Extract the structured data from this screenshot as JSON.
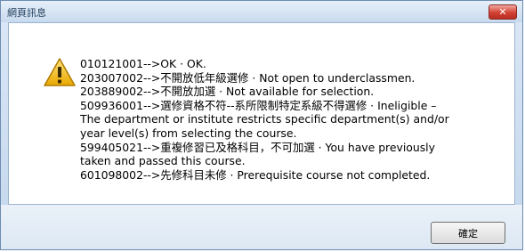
{
  "window": {
    "title": "網頁訊息",
    "close_label": "✕"
  },
  "message": {
    "lines": [
      "010121001-->OK · OK.",
      "203007002-->不開放低年級選修 · Not open to underclassmen.",
      "203889002-->不開放加選 · Not available for selection.",
      "509936001-->選修資格不符--系所限制特定系級不得選修 · Ineligible –",
      "The department or institute restricts specific department(s) and/or",
      "year level(s) from selecting the course.",
      "599405021-->重複修習已及格科目，不可加選 · You have previously",
      "taken and passed this course.",
      "601098002-->先修科目未修 · Prerequisite course not completed."
    ]
  },
  "buttons": {
    "ok_label": "確定"
  },
  "icons": {
    "warning": "warning-icon",
    "close": "close-icon"
  },
  "colors": {
    "close_button": "#d24033",
    "warning_fill": "#f2c200"
  }
}
